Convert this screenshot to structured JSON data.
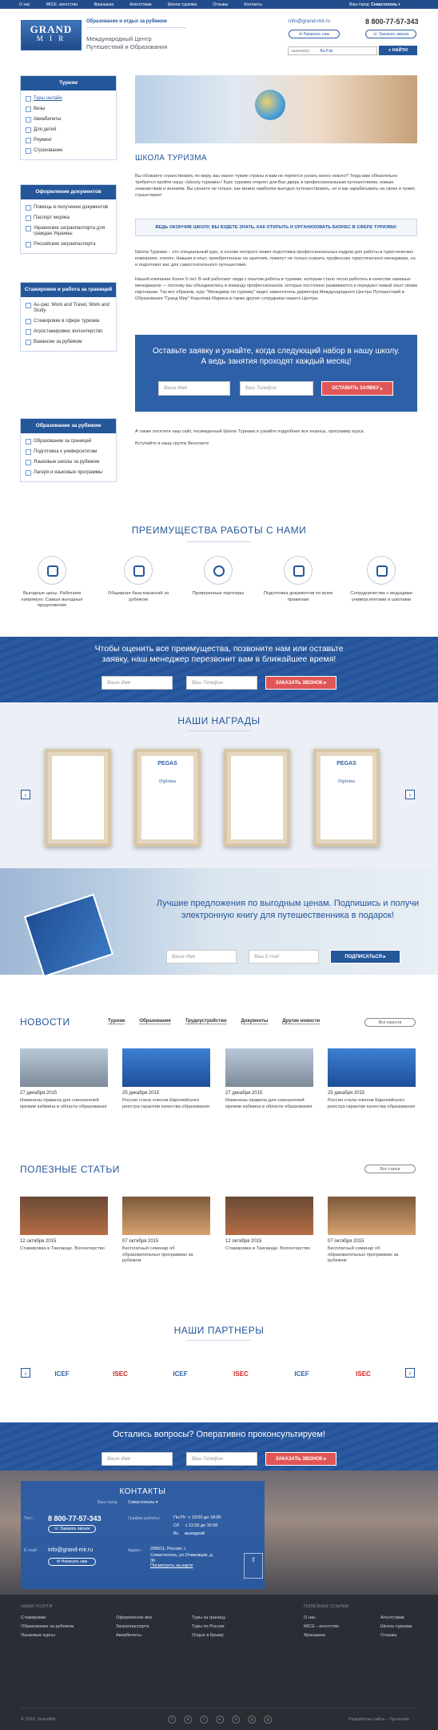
{
  "topnav": {
    "items": [
      "О нас",
      "MICE- агентство",
      "Франшиза",
      "Агентствам",
      "Школа туризма",
      "Отзывы",
      "Контакты"
    ],
    "city_label": "Ваш город:",
    "city": "Севастополь"
  },
  "header": {
    "logo_line1": "GRAND",
    "logo_line2": "M I R",
    "tagline": "Образование и отдых за рубежом",
    "subtitle": "Международный Центр Путешествий и Образования",
    "email": "info@grand-mir.ru",
    "phone": "8 800-77-57-343",
    "write_btn": "Написать нам",
    "callback_btn": "Заказать звонок",
    "search_label": "например:",
    "search_value": "Au-Pair",
    "search_btn": "НАЙТИ"
  },
  "sidebar": [
    {
      "title": "Туризм",
      "items": [
        "Туры онлайн",
        "Визы",
        "Авиабилеты",
        "Для детей",
        "Роуминг",
        "Страхование"
      ]
    },
    {
      "title": "Оформление документов",
      "items": [
        "Помощь в получении документов",
        "Паспорт моряка",
        "Украинские загранпаспорта для граждан Украины",
        "Российские загранпаспорта"
      ]
    },
    {
      "title": "Стажировки и работа за границей",
      "items": [
        "Au-pair, Work and Travel, Work and Study",
        "Стажировки в сфере туризма",
        "Агростажировки, волонтерство",
        "Вакансии за рубежом"
      ]
    },
    {
      "title": "Образование за рубежом",
      "items": [
        "Образование за границей",
        "Подготовка к университетам",
        "Языковые школы за рубежом",
        "Лагеря и языковые программы"
      ]
    }
  ],
  "main": {
    "title": "ШКОЛА ТУРИЗМА",
    "p1": "Вы обожаете странствовать по миру, вас манят чужие страны и вам не терпится узнать много нового? Тогда вам обязательно требуется пройти нашу «Школу туризма»! Курс туризма откроет для Вас дверь в профессиональным путешествиям, новым знакомствам и знаниям. Вы узнаете не только, как можно наиболее выгодно путешествовать, но и как зарабатывать на своих и чужих странствиях!",
    "callout": "ВЕДЬ ОКОНЧИВ ШКОЛУ, ВЫ БУДЕТЕ ЗНАТЬ, КАК ОТКРЫТЬ И ОРГАНИЗОВАТЬ БИЗНЕС В СФЕРЕ ТУРИЗМА!",
    "p2": "Школа Туризма – это специальный курс, в основе которого лежит подготовка профессиональных кадров для работы в туристических компаниях, отелях. Навыки и опыт, приобретенные на занятиях, помогут не только освоить профессию туристического менеджера, но и подготовят вас для самостоятельного путешествия.",
    "p3": "Нашей компании более 5 лет. В ней работают люди с опытом работы в туризме, которым стало тесно работать в качестве наемных менеджеров — поэтому мы объединились в команду профессионалов, которые постоянно развиваются и передают новый опыт своим партнерам. Так вот образом, курс \"Менеджер по туризму\" ведет заместитель директора Международного Центра Путешествий и Образования \"Гранд Мир\" Корытева Марина в также другие сотрудники нашего Центра.",
    "form_title": "Оставьте заявку и узнайте, когда следующий набор в нашу школу.  А ведь занятия проходят каждый месяц!",
    "name_ph": "Ваше Имя",
    "phone_ph": "Ваш Телефон",
    "submit": "ОСТАВИТЬ ЗАЯВКУ",
    "p4": "А также посетите наш сайт, посвященный Школе Туризма и узнайте подробнее все нюансы, программу курса.",
    "p5": "Вступайте в нашу группу Вконтакте"
  },
  "advantages": {
    "title": "ПРЕИМУЩЕСТВА РАБОТЫ С НАМИ",
    "items": [
      "Выгодные цены. Работаем напрямую. Самые выгодные предложения",
      "Общирная база вакансий за рубежом",
      "Проверенные партнеры",
      "Подготовка документов по всем правилам",
      "Сотрудничество с ведущими университетами и школами"
    ]
  },
  "call_band": {
    "title": "Чтобы оценить все преимущества, позвоните нам или оставьте заявку, наш менеджер перезвонит вам в ближайшее время!",
    "name_ph": "Ваше Имя",
    "phone_ph": "Ваш Телефон",
    "btn": "ЗАКАЗАТЬ ЗВОНОК"
  },
  "awards": {
    "title": "НАШИ НАГРАДЫ",
    "items": [
      {
        "brand": "",
        "label": ""
      },
      {
        "brand": "PEGAS",
        "label": "Diploma"
      },
      {
        "brand": "",
        "label": ""
      },
      {
        "brand": "PEGAS",
        "label": "Diploma"
      }
    ]
  },
  "promo": {
    "title": "Лучшие предложения по выгодным ценам. Подпишись и получи электронную книгу для путешественника в подарок!",
    "name_ph": "Ваше Имя",
    "email_ph": "Ваш E-mail",
    "btn": "ПОДПИСАТЬСЯ"
  },
  "news": {
    "title": "НОВОСТИ",
    "tabs": [
      "Туризм",
      "Образование",
      "Трудоустройство",
      "Документы",
      "Другие новости"
    ],
    "all": "Все новости",
    "items": [
      {
        "date": "27 декабря 2015",
        "text": "Изменены правила для соискателей премии кабмина в области образования"
      },
      {
        "date": "25 декабря 2015",
        "text": "Россия стала членом Европейского реестра гарантии качества образования"
      },
      {
        "date": "27 декабря 2015",
        "text": "Изменены правила для соискателей премии кабмина в области образования"
      },
      {
        "date": "25 декабря 2015",
        "text": "Россия стала членом Европейского реестра гарантии качества образования"
      }
    ]
  },
  "articles": {
    "title": "ПОЛЕЗНЫЕ СТАТЬИ",
    "all": "Все статьи",
    "items": [
      {
        "date": "12 октября 2015",
        "text": "Стажировка в Таиланде. Волонтерство"
      },
      {
        "date": "07 октября 2015",
        "text": "Бесплатный семинар об образовательных программах за рубежом"
      },
      {
        "date": "12 октября 2015",
        "text": "Стажировка в Таиланде. Волонтерство"
      },
      {
        "date": "07 октября 2015",
        "text": "Бесплатный семинар об образовательных программах за рубежом"
      }
    ]
  },
  "partners": {
    "title": "НАШИ ПАРТНЕРЫ",
    "items": [
      "ICEF",
      "ISEC",
      "ICEF",
      "ISEC",
      "ICEF",
      "ISEC"
    ]
  },
  "consult": {
    "title": "Остались вопросы? Оперативно проконсультируем!",
    "name_ph": "Ваше Имя",
    "phone_ph": "Ваш Телефон",
    "btn": "ЗАКАЗАТЬ ЗВОНОК"
  },
  "contacts": {
    "title": "КОНТАКТЫ",
    "city_label": "Ваш город:",
    "city": "Севастополь",
    "tel_label": "Тел.:",
    "phone": "8 800-77-57-343",
    "callback": "Заказать звонок",
    "email_label": "E-mail:",
    "email": "info@grand-mir.ru",
    "write": "Написать нам",
    "hours_label": "График работы:",
    "hours": [
      [
        "Пн-Пт",
        "с 10:00 до 18:00"
      ],
      [
        "Сб",
        "с 11:00 до 15:00"
      ],
      [
        "Вс",
        "выходной"
      ]
    ],
    "addr_label": "Адрес:",
    "address": "299011, Россия, г. Севастополь, ул.Очаковцев, д. 36",
    "map": "Посмотреть на карте"
  },
  "footer": {
    "col1_title": "НАШИ УСЛУГИ",
    "col1": [
      "Стажировки",
      "Образование за рубежом",
      "Языковые курсы"
    ],
    "col2": [
      "Оформление виз",
      "Загранпаспорта",
      "Авиабилеты"
    ],
    "col3": [
      "Туры за границу",
      "Туры по России",
      "Отдых в Крыму"
    ],
    "col4_title": "ПОЛЕЗНЫЕ ССЫЛКИ",
    "col4": [
      "О нас",
      "MICE - агентство",
      "Франшиза"
    ],
    "col5": [
      "Агентствам",
      "Школа туризма",
      "Отзывы"
    ],
    "copyright": "© 2016, GrandMir",
    "dev": "Разработка сайта – Spravweb"
  },
  "colors": {
    "brand": "#24569a",
    "accent": "#e05656",
    "footer": "#2a2d33"
  }
}
